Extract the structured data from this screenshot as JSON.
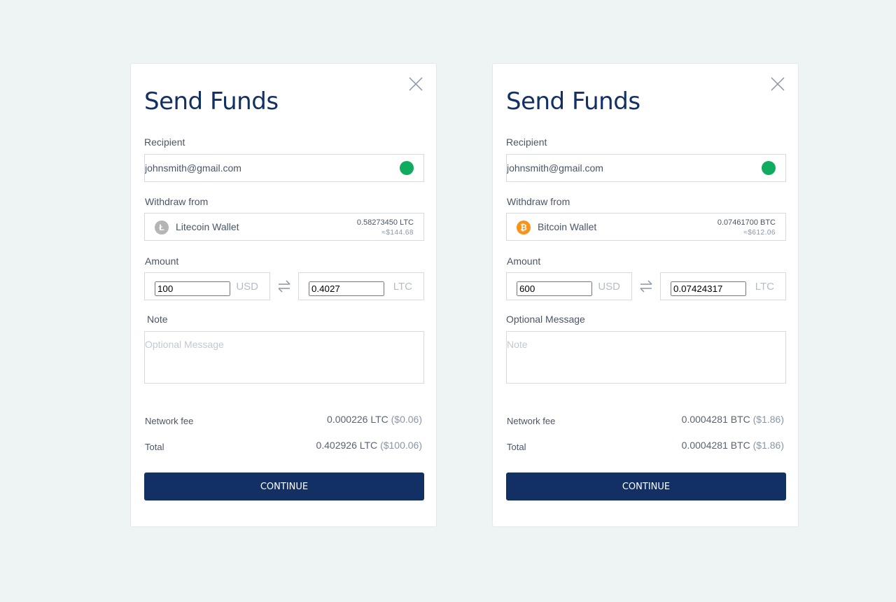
{
  "colors": {
    "background": "#eef3f3",
    "brand_navy": "#133065",
    "status_green": "#0fab5e",
    "litecoin_gray": "#b5b5b5",
    "bitcoin_orange": "#f7931a"
  },
  "panels": [
    {
      "title": "Send Funds",
      "close_icon": "close-x-icon",
      "recipient_label": "Recipient",
      "recipient_value": "johnsmith@gmail.com",
      "recipient_status": "verified",
      "withdraw_label": "Withdraw from",
      "wallet": {
        "icon": "litecoin-icon",
        "icon_glyph": "Ł",
        "name": "Litecoin Wallet",
        "balance": "0.58273450 LTC",
        "balance_usd": "≈$144.68"
      },
      "amount_label": "Amount",
      "amount_usd": "100",
      "amount_usd_unit": "USD",
      "swap_icon": "swap-arrows-icon",
      "amount_crypto": "0.4027",
      "amount_crypto_unit": "LTC",
      "note_label": "Note",
      "note_placeholder": "Optional Message",
      "fee_label": "Network fee",
      "fee_crypto": "0.000226 LTC",
      "fee_usd": "($0.06)",
      "total_label": "Total",
      "total_crypto": "0.402926 LTC",
      "total_usd": "($100.06)",
      "continue_label": "CONTINUE"
    },
    {
      "title": "Send Funds",
      "close_icon": "close-x-icon",
      "recipient_label": "Recipient",
      "recipient_value": "johnsmith@gmail.com",
      "recipient_status": "verified",
      "withdraw_label": "Withdraw from",
      "wallet": {
        "icon": "bitcoin-icon",
        "icon_glyph": "₿",
        "name": "Bitcoin Wallet",
        "balance": "0.07461700 BTC",
        "balance_usd": "≈$612.06"
      },
      "amount_label": "Amount",
      "amount_usd": "600",
      "amount_usd_unit": "USD",
      "swap_icon": "swap-arrows-icon",
      "amount_crypto": "0.07424317",
      "amount_crypto_unit": "LTC",
      "note_label": "Optional Message",
      "note_placeholder": "Note",
      "fee_label": "Network fee",
      "fee_crypto": "0.0004281 BTC",
      "fee_usd": "($1.86)",
      "total_label": "Total",
      "total_crypto": "0.0004281 BTC",
      "total_usd": "($1.86)",
      "continue_label": "CONTINUE"
    }
  ]
}
